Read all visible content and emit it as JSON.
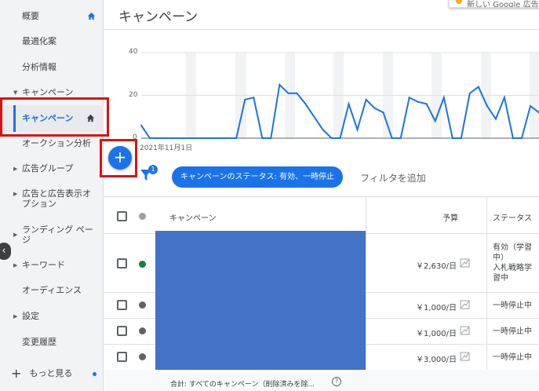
{
  "sidebar": {
    "items": [
      {
        "label": "概要"
      },
      {
        "label": "最適化案"
      },
      {
        "label": "分析情報"
      },
      {
        "label": "キャンペーン"
      },
      {
        "label": "キャンペーン"
      },
      {
        "label": "オークション分析"
      },
      {
        "label": "広告グループ"
      },
      {
        "label": "広告と広告表示オプション"
      },
      {
        "label": "ランディング ページ"
      },
      {
        "label": "キーワード"
      },
      {
        "label": "オーディエンス"
      },
      {
        "label": "設定"
      },
      {
        "label": "変更履歴"
      }
    ],
    "more_label": "もっと見る"
  },
  "header": {
    "title": "キャンペーン",
    "toast": "新しい Google 広告"
  },
  "chart_data": {
    "type": "line",
    "y_ticks": [
      "40",
      "20",
      "0"
    ],
    "ylim": [
      0,
      40
    ],
    "x_start_label": "2021年11月1日",
    "grid": true,
    "color": "#1a73e8",
    "values": [
      6,
      0,
      0,
      0,
      0,
      0,
      0,
      0,
      0,
      0,
      0,
      0,
      18,
      19,
      0,
      0,
      25,
      21,
      21,
      16,
      10,
      4,
      0,
      0,
      16,
      4,
      18,
      14,
      12,
      0,
      0,
      19,
      17,
      16,
      8,
      19,
      0,
      0,
      21,
      24,
      15,
      9,
      19,
      0,
      0,
      15,
      12
    ]
  },
  "filter_bar": {
    "filter_count": "1",
    "chip_label": "キャンペーンのステータス: 有効、一時停止",
    "add_filter": "フィルタを追加"
  },
  "table": {
    "headers": {
      "campaign": "キャンペーン",
      "budget": "予算",
      "status": "ステータス"
    },
    "rows": [
      {
        "budget": "￥2,630/日",
        "status_lines": [
          "有効（学習",
          "中）",
          "入札戦略学",
          "習中"
        ],
        "dot_color": "#188038"
      },
      {
        "budget": "￥1,000/日",
        "status_lines": [
          "一時停止中"
        ],
        "dot_color": "#5f6368"
      },
      {
        "budget": "￥1,000/日",
        "status_lines": [
          "一時停止中"
        ],
        "dot_color": "#5f6368"
      },
      {
        "budget": "￥3,000/日",
        "status_lines": [
          "一時停止中"
        ],
        "dot_color": "#5f6368"
      }
    ],
    "total_label": "合計: すべてのキャンペーン（削除済みを除..."
  },
  "colors": {
    "accent": "#1a73e8",
    "highlight": "#e01010",
    "mask": "#4472c4"
  }
}
